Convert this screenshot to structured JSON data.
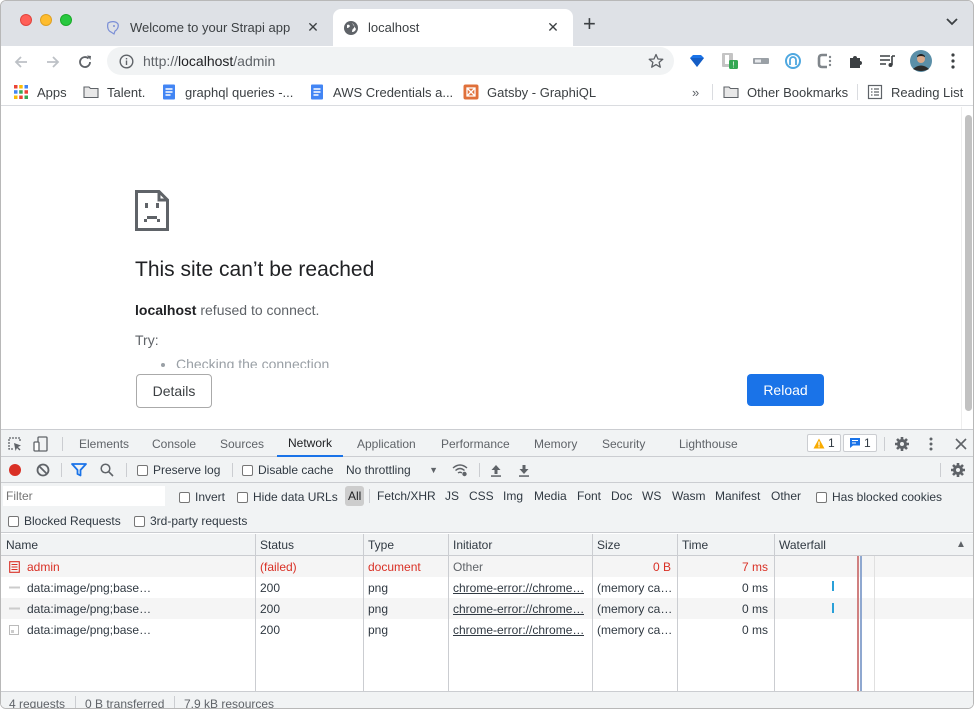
{
  "browser": {
    "tabs": [
      {
        "title": "Welcome to your Strapi app",
        "icon": "strapi-icon",
        "active": false
      },
      {
        "title": "localhost",
        "icon": "globe-icon",
        "active": true
      }
    ],
    "new_tab": "+",
    "address": {
      "prefix": "http://",
      "host": "localhost",
      "path": "/admin"
    },
    "extensions": [
      "sketch-gem-icon",
      "extension-warning-icon",
      "extension-tag-icon",
      "redux-devtools-icon",
      "c-extension-icon",
      "puzzle-icon",
      "media-control-icon",
      "profile-avatar",
      "more-menu-icon"
    ],
    "extension_badge": "!",
    "bookmarks": [
      {
        "label": "Apps",
        "icon": "apps-grid-icon"
      },
      {
        "label": "Talent.",
        "icon": "folder-icon"
      },
      {
        "label": "graphql queries -...",
        "icon": "google-doc-icon"
      },
      {
        "label": "AWS Credentials a...",
        "icon": "google-doc-icon"
      },
      {
        "label": "Gatsby - GraphiQL",
        "icon": "graphiql-icon"
      }
    ],
    "bookmarks_overflow": "»",
    "other_bookmarks": "Other Bookmarks",
    "reading_list": "Reading List"
  },
  "page": {
    "title": "This site can’t be reached",
    "host": "localhost",
    "message": " refused to connect.",
    "try_label": "Try:",
    "suggestions": [
      "Checking the connection"
    ],
    "details_button": "Details",
    "reload_button": "Reload"
  },
  "devtools": {
    "tabs": [
      "Elements",
      "Console",
      "Sources",
      "Network",
      "Application",
      "Performance",
      "Memory",
      "Security",
      "Lighthouse"
    ],
    "active_tab": "Network",
    "warnings_count": "1",
    "messages_count": "1",
    "toolbar": {
      "preserve_log": "Preserve log",
      "disable_cache": "Disable cache",
      "throttling": "No throttling"
    },
    "filter": {
      "placeholder": "Filter",
      "invert": "Invert",
      "hide_data_urls": "Hide data URLs",
      "types": [
        "All",
        "Fetch/XHR",
        "JS",
        "CSS",
        "Img",
        "Media",
        "Font",
        "Doc",
        "WS",
        "Wasm",
        "Manifest",
        "Other"
      ],
      "active_type": "All",
      "has_blocked_cookies": "Has blocked cookies",
      "blocked_requests": "Blocked Requests",
      "third_party": "3rd-party requests"
    },
    "columns": [
      "Name",
      "Status",
      "Type",
      "Initiator",
      "Size",
      "Time",
      "Waterfall"
    ],
    "sort_indicator": "▲",
    "rows": [
      {
        "name": "admin",
        "status": "(failed)",
        "type": "document",
        "initiator": "Other",
        "size": "0 B",
        "time": "7 ms",
        "failed": true,
        "icon": "document-icon"
      },
      {
        "name": "data:image/png;base…",
        "status": "200",
        "type": "png",
        "initiator": "chrome-error://chrome…",
        "size": "(memory ca…",
        "time": "0 ms",
        "failed": false,
        "icon": "image-line-icon"
      },
      {
        "name": "data:image/png;base…",
        "status": "200",
        "type": "png",
        "initiator": "chrome-error://chrome…",
        "size": "(memory ca…",
        "time": "0 ms",
        "failed": false,
        "icon": "image-line-icon"
      },
      {
        "name": "data:image/png;base…",
        "status": "200",
        "type": "png",
        "initiator": "chrome-error://chrome…",
        "size": "(memory ca…",
        "time": "0 ms",
        "failed": false,
        "icon": "image-thumb-icon"
      }
    ],
    "summary": {
      "requests": "4 requests",
      "transferred": "0 B transferred",
      "resources": "7.9 kB resources"
    }
  },
  "colors": {
    "accent": "#1a73e8",
    "error": "#d93025",
    "warning": "#f9ab00"
  }
}
